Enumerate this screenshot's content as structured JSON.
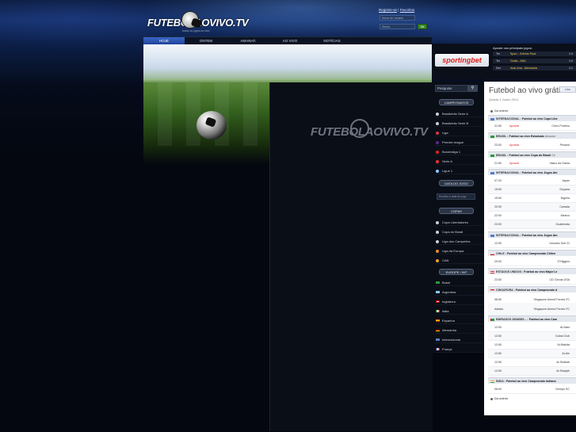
{
  "header": {
    "logo_text": "FUTEBOLAOVIVO.TV",
    "logo_sub": "todos os jogos ao vivo",
    "register_label": "Registre-se",
    "favorites_label": "Favoritos",
    "login_placeholder": "Nome de Usuário",
    "password_placeholder": "Senha",
    "go_label": "Ok"
  },
  "nav": {
    "items": [
      "HOJE",
      "ONTEM",
      "AMANHÃ",
      "AO VIVO",
      "NOTÍCIAS"
    ],
    "active": 0
  },
  "hero": {
    "watermark": "FUTEBOLAOVIVO.TV"
  },
  "ads": {
    "brand": "sportingbet",
    "headline": "Aposte nos principais jogos:",
    "rows": [
      {
        "day": "Ter",
        "match": "Sport - Grêmio Prud.",
        "time": "1:3"
      },
      {
        "day": "Ter",
        "match": "Goiás - ASA",
        "time": "1:0"
      },
      {
        "day": "Sex",
        "match": "Avaí-Ana - Alemanha",
        "time": "1:1"
      }
    ]
  },
  "sidebar": {
    "search_label": "Pesquise",
    "campeonatos_title": "CAMPEONATOS",
    "campeonatos": [
      "Brasileirão Serie A",
      "Brasileirão Serie B",
      "Liga",
      "Premier league",
      "Bundesliga 1",
      "Serie A",
      "Ligue 1"
    ],
    "data_title": "DATA DO JOGO",
    "data_placeholder": "Escolha a data do jogo",
    "copas_title": "COPAS",
    "copas": [
      "Copa Libertadores",
      "Copa do Brasil",
      "Liga dos Campeões",
      "Liga da Europa",
      "CAN"
    ],
    "europe_title": "EUROPE / INT",
    "europe": [
      "Brasil",
      "Argentina",
      "Inglaterra",
      "Itália",
      "Espanha",
      "Alemanha",
      "Internacional",
      "França"
    ]
  },
  "main": {
    "title": "Futebol ao vivo grátis",
    "date": "Quarta 1 Junho 2011",
    "like_label": "Like",
    "prev_label": "Dia anterior",
    "next_label": "Dia anterior",
    "sections": [
      {
        "country": "INTERNACIONAL",
        "league": "Futebol ao vivo Copa Libe"
      },
      {
        "country": "BRASIL",
        "league": "Futebol ao vivo Estaduais",
        "extra": "Amazon"
      },
      {
        "country": "BRASIL",
        "league": "Futebol ao vivo Copa do Brasil",
        "extra": "Cir"
      },
      {
        "country": "INTERNACIONAL",
        "league": "Futebol ao vivo Jogos Am"
      },
      {
        "country": "INTERNACIONAL",
        "league": "Futebol ao vivo Jogos Am"
      },
      {
        "country": "CHILE",
        "league": "Futebol ao vivo Campeonato Chilen"
      },
      {
        "country": "ESTADOS UNIDOS",
        "league": "Futebol ao vivo Major Le"
      },
      {
        "country": "CINGAPURA",
        "league": "Futebol ao vivo Campeonato d"
      },
      {
        "country": "EMIRADOS ÁRABES...",
        "league": "Futebol ao vivo Cam"
      },
      {
        "country": "ÍNDIA",
        "league": "Futebol ao vivo Campeonato Indiano"
      }
    ],
    "matches": [
      {
        "time": "21:50",
        "apostar": "Apostar",
        "team": "Cerro Porteno"
      },
      {
        "time": "23:00",
        "apostar": "Apostar",
        "team": "Penarol"
      },
      {
        "time": "21:50",
        "apostar": "Apostar",
        "team": "Vasco da Gama"
      },
      {
        "time": "07:20",
        "team": "Japan"
      },
      {
        "time": "15:50",
        "team": "Guyana"
      },
      {
        "time": "15:50",
        "team": "Nigeria"
      },
      {
        "time": "20:00",
        "team": "Canada"
      },
      {
        "time": "22:00",
        "team": "Mexico"
      },
      {
        "time": "23:00",
        "team": "Guatemala"
      },
      {
        "time": "12:50",
        "team": "Uniones Sub 21"
      },
      {
        "time": "20:00",
        "team": "O'Higgins"
      },
      {
        "time": "23:50",
        "team": "CD Chivas USA"
      },
      {
        "time": "08:50",
        "team": "Singapore Armed Forces FC"
      },
      {
        "time": "Adiado",
        "team": "Singapore Armed Forces FC"
      },
      {
        "time": "12:50",
        "team": "Al-Nasr"
      },
      {
        "time": "12:50",
        "team": "Dubai Club"
      },
      {
        "time": "12:50",
        "team": "Al-Wahda"
      },
      {
        "time": "12:50",
        "team": "Al-Ain"
      },
      {
        "time": "12:50",
        "team": "Al-Shabab"
      },
      {
        "time": "12:50",
        "team": "Al-Sharjah"
      },
      {
        "time": "08:00",
        "team": "Dempo SC"
      }
    ]
  }
}
